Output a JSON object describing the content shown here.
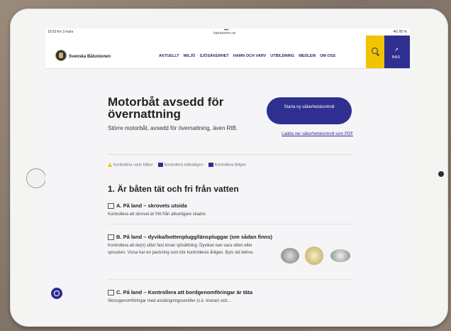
{
  "status": {
    "time": "10:53",
    "date": "fre 3 mars",
    "url": "batunionen.se",
    "battery": "4G 95 %"
  },
  "header": {
    "brand": "Svenska Båtunionen",
    "nav": [
      "AKTUELLT",
      "MILJÖ",
      "SJÖSÄKERHET",
      "HAMN OCH VARV",
      "UTBILDNING",
      "MEDLEM",
      "OM OSS"
    ],
    "account_label": "BAS"
  },
  "main": {
    "title": "Motorbåt avsedd för övernattning",
    "subtitle": "Större motorbåt, avsedd för övernattning, även RIB.",
    "start_button": "Starta ny säkerhetskontroll",
    "pdf_link": "Ladda ner säkerhetskontroll som PDF",
    "legend": [
      "Kontrollera varje båttur",
      "Kontrollera månatligen",
      "Kontrollera årligen"
    ],
    "section_title": "1. Är båten tät och fri från vatten",
    "items": [
      {
        "title": "A. På land – skrovets utsida",
        "desc": "Kontrollera att skrovet är fritt från allvarligare skador."
      },
      {
        "title": "B. På land – dyvika/bottenplugg/länspluggar (om sådan finns)",
        "desc": "Kontrollera att de(n) sitter fast innan sjösättning. Dyvikan kan vara sliten eller sprucken. Vissa har en packning som bör kontrolleras årligen. Byts vid behov."
      },
      {
        "title": "C. På land – Kontrollera att bordgenomföringar är täta",
        "desc": "Skrovgenomföringar med avstängningsventiler (s.k. kranar) och..."
      }
    ]
  },
  "colors": {
    "brand_blue": "#2e2f8e",
    "accent_yellow": "#f2c300"
  }
}
